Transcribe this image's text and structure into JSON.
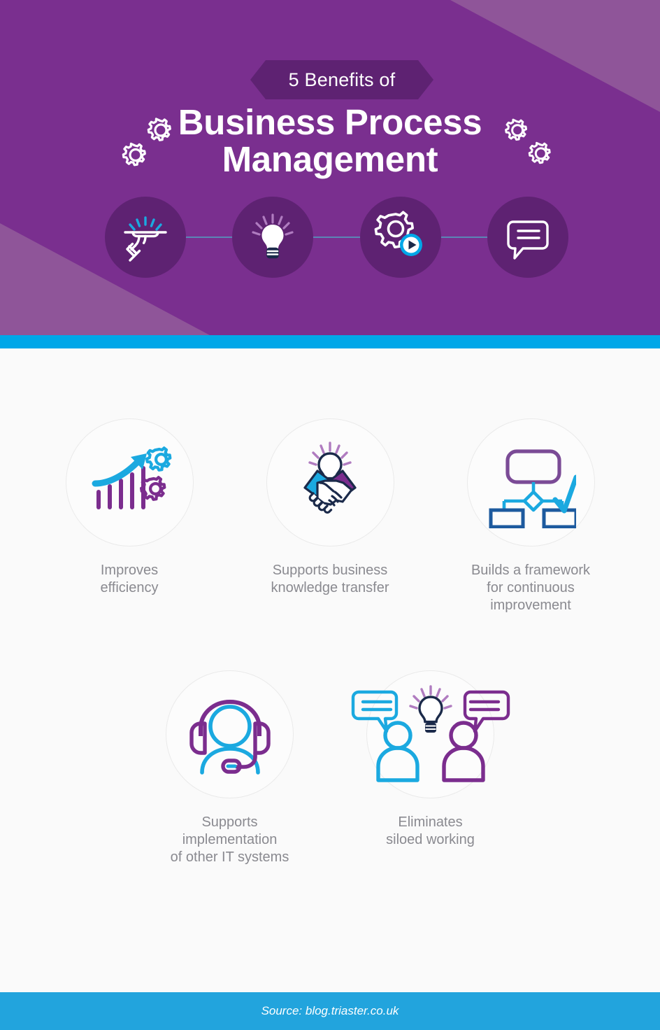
{
  "header": {
    "ribbon_label": "5 Benefits of",
    "title_line1": "Business Process",
    "title_line2": "Management",
    "background_color": "#7a2f8f",
    "ribbon_color": "#5e2272",
    "corner_accent_color": "#8f5599",
    "circle_color": "#5e2272",
    "connector_color": "#5b86b5",
    "decor_icons": [
      "gears-icon-left",
      "gears-icon-right"
    ],
    "step_icons": [
      {
        "name": "hand-tray-icon",
        "accent": "#1ba9e0"
      },
      {
        "name": "lightbulb-icon",
        "accent": "#ffffff"
      },
      {
        "name": "gear-play-icon",
        "accent": "#00a7e8"
      },
      {
        "name": "speech-bubble-icon",
        "accent": "#ffffff"
      }
    ]
  },
  "divider": {
    "color": "#00a7e8"
  },
  "benefits": [
    {
      "id": 1,
      "icon": "growth-chart-gears-icon",
      "caption_line1": "Improves",
      "caption_line2": "efficiency",
      "caption": "Improves efficiency"
    },
    {
      "id": 2,
      "icon": "handshake-lightbulb-icon",
      "caption_line1": "Supports business",
      "caption_line2": "knowledge transfer",
      "caption": "Supports business knowledge transfer"
    },
    {
      "id": 3,
      "icon": "flowchart-checkmark-icon",
      "caption_line1": "Builds a framework",
      "caption_line2": "for continuous",
      "caption_line3": "improvement",
      "caption": "Builds a framework for continuous improvement"
    },
    {
      "id": 4,
      "icon": "headset-support-icon",
      "caption_line1": "Supports",
      "caption_line2": "implementation",
      "caption_line3": "of other IT systems",
      "caption": "Supports implementation of other IT systems"
    },
    {
      "id": 5,
      "icon": "people-speech-lightbulb-icon",
      "caption_line1": "Eliminates",
      "caption_line2": "siloed working",
      "caption": "Eliminates siloed working"
    }
  ],
  "palette": {
    "purple": "#7a2f8f",
    "dark_purple": "#5e2272",
    "light_purple": "#8f5599",
    "blue": "#00a7e8",
    "dark_blue": "#1d5a9e",
    "navy": "#1b2a4a",
    "gray_text": "#8a8a90",
    "page_background": "#fafafa",
    "circle_outline": "#eaeaea"
  },
  "footer": {
    "source_text": "Source: blog.triaster.co.uk",
    "background_color": "#22a4dd"
  }
}
